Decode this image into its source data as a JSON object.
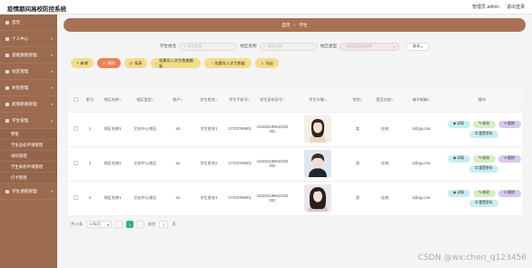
{
  "app": {
    "title": "疫情期间高校防控系统",
    "user_label": "管理员 admin",
    "logout_label": "退出登录"
  },
  "sidebar": {
    "items": [
      {
        "label": "首页"
      },
      {
        "label": "个人中心"
      },
      {
        "label": "基础数据管理"
      },
      {
        "label": "地区管理"
      },
      {
        "label": "体检管理"
      },
      {
        "label": "疫情新闻管理"
      },
      {
        "label": "学生管理"
      },
      {
        "label": "学生"
      },
      {
        "label": "学生返校申请管理"
      },
      {
        "label": "采样管理"
      },
      {
        "label": "学生离校申请管理"
      },
      {
        "label": "打卡管理"
      },
      {
        "label": "学生请假管理"
      }
    ]
  },
  "breadcrumb": {
    "home": "首页",
    "sep": "/",
    "current": "学生"
  },
  "search": {
    "name_label": "学生姓名",
    "name_placeholder": "学生姓名",
    "region_label": "地区名称",
    "region_placeholder": "地区名称",
    "type_label": "地区类型",
    "type_placeholder": "地区类型请选择",
    "query_label": "查询"
  },
  "toolbar": {
    "add": "新增",
    "delete": "删除",
    "stat": "报表",
    "import_template": "批量导入学生数据模板",
    "import_data": "批量导入学生数据",
    "export": "导出"
  },
  "table": {
    "headers": [
      "",
      "索引",
      "地区名称",
      "地区类型",
      "账户",
      "学生姓名",
      "学生手机号",
      "学生身份证号",
      "学生头像",
      "性别",
      "是否在校",
      "电子邮箱",
      "操作"
    ],
    "rows": [
      {
        "index": "1",
        "region": "地区名称1",
        "type": "文化中心地区",
        "account": "a3",
        "name": "学生姓名1",
        "phone": "17703786901",
        "idcard": "410224199610232001",
        "avatar": "girl-1",
        "gender": "女",
        "in_school": "在校",
        "email": "1@qq.com"
      },
      {
        "index": "2",
        "region": "地区名称2",
        "type": "文化中心地区",
        "account": "a2",
        "name": "学生姓名2",
        "phone": "17703786902",
        "idcard": "410224199610232002",
        "avatar": "boy-1",
        "gender": "男",
        "in_school": "在校",
        "email": "1@qq.com"
      },
      {
        "index": "3",
        "region": "地区名称1",
        "type": "文化中心地区",
        "account": "a1",
        "name": "学生姓名1",
        "phone": "17703786901",
        "idcard": "410224199610232002",
        "avatar": "girl-2",
        "gender": "男",
        "in_school": "在校",
        "email": "1@qq.com"
      }
    ],
    "ops": {
      "view": "详情",
      "edit": "修改",
      "delete": "删除",
      "reset": "重置密码"
    }
  },
  "pager": {
    "total": "共 3 条",
    "size": "10条/页",
    "current": "1",
    "goto_prefix": "前往",
    "goto_value": "1",
    "goto_suffix": "页"
  },
  "watermark": "CSDN @wx:chen_q123456",
  "colors": {
    "sidebar": "#9c6a4f",
    "breadcrumb": "#a87255",
    "accent_yellow": "#f3dc8a",
    "accent_orange": "#ef7f55",
    "page_active": "#2fae86"
  }
}
